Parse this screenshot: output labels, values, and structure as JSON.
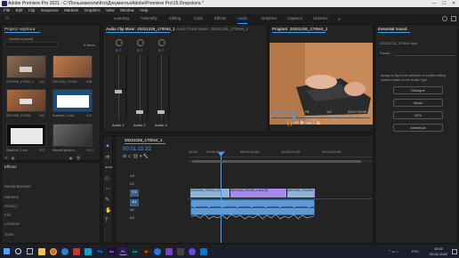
{
  "window": {
    "title": "Adobe Premiere Pro 2021 - C:\\Пользователи\\Кто\\Документы\\Adobe\\Premiere Pro\\15.0\\repokora *"
  },
  "menu": [
    "File",
    "Edit",
    "Clip",
    "Sequence",
    "Markers",
    "Graphics",
    "View",
    "Window",
    "Help"
  ],
  "workspaces": [
    "Learning",
    "Assembly",
    "Editing",
    "Color",
    "Effects",
    "Audio",
    "Graphics",
    "Captions",
    "Libraries"
  ],
  "active_workspace": "Audio",
  "project": {
    "tab": "Project: repokora",
    "file": "repokora.prproj",
    "search_placeholder": "",
    "item_count": "9 Items",
    "clips": [
      {
        "name": "20221226_170044_1...",
        "duration": "1:21"
      },
      {
        "name": "20221226_170108...",
        "duration": "0:56"
      },
      {
        "name": "20221226_170159...",
        "duration": "0:43"
      },
      {
        "name": "Superbob_2.mp4",
        "duration": "0:12"
      },
      {
        "name": "Superbob_2.mov",
        "duration": "0:07"
      },
      {
        "name": "sfbecdsf.pedak.m...",
        "duration": "12:17"
      }
    ]
  },
  "lower_left_panels": [
    "Effects",
    "Media Browser",
    "Markers",
    "History",
    "Info",
    "Libraries",
    "Tools"
  ],
  "audio_clip_mixer": {
    "tab": "Audio Clip Mixer: 20221226_170044_1",
    "tab2": "Audio Track Mixer: 20221226_170044_1",
    "channels": [
      "Audio 1",
      "Audio 2",
      "Audio 3"
    ],
    "values": [
      "0.0",
      "0.0",
      "0.0"
    ],
    "buttons": [
      "M",
      "S",
      "R"
    ]
  },
  "program": {
    "tab": "Program: 20221226_170044_1",
    "timecode": "00:01:15:33",
    "fit": "Fit",
    "resolution": "1/2",
    "duration": "00:07:59:00"
  },
  "essential_sound": {
    "tab": "Essential Sound",
    "clip": "20221226_170044.mp4",
    "preset_label": "Preset",
    "preset": "",
    "hint": "Assign a Tag to the selection to enable editing options based on the Audio Type.",
    "types": [
      "Dialogue",
      "Music",
      "SFX",
      "Ambience"
    ]
  },
  "timeline": {
    "tab": "20221226_170044_1",
    "timecode": "00:01:15:33",
    "ruler": [
      "00:00",
      "00:00:08:00",
      "00:00:16:00",
      "00:00:24:00",
      "00:00:32:00"
    ],
    "video_tracks": [
      "V3",
      "V2",
      "V1"
    ],
    "audio_tracks": [
      "A1",
      "A2",
      "A3"
    ],
    "clip_v1_a": "20221226_170044_1 [V]",
    "clip_v1_b": "20221226_170108_1.mp4 [V]",
    "clip_v1_c": "20221226_170159.mp4 [V]",
    "clip_v1_d": "20221226_1"
  },
  "taskbar": {
    "search_icon": "search-icon",
    "apps": [
      "Ps",
      "Ae",
      "Pr",
      "Au",
      "Ai"
    ],
    "time": "15:02",
    "date": "05.01.2022",
    "lang": "РУС"
  },
  "colors": {
    "accent": "#3ea0ff",
    "video_clip": "#8fb4d6",
    "audio_clip": "#5d9ad6",
    "purple": "#a78ce6"
  }
}
